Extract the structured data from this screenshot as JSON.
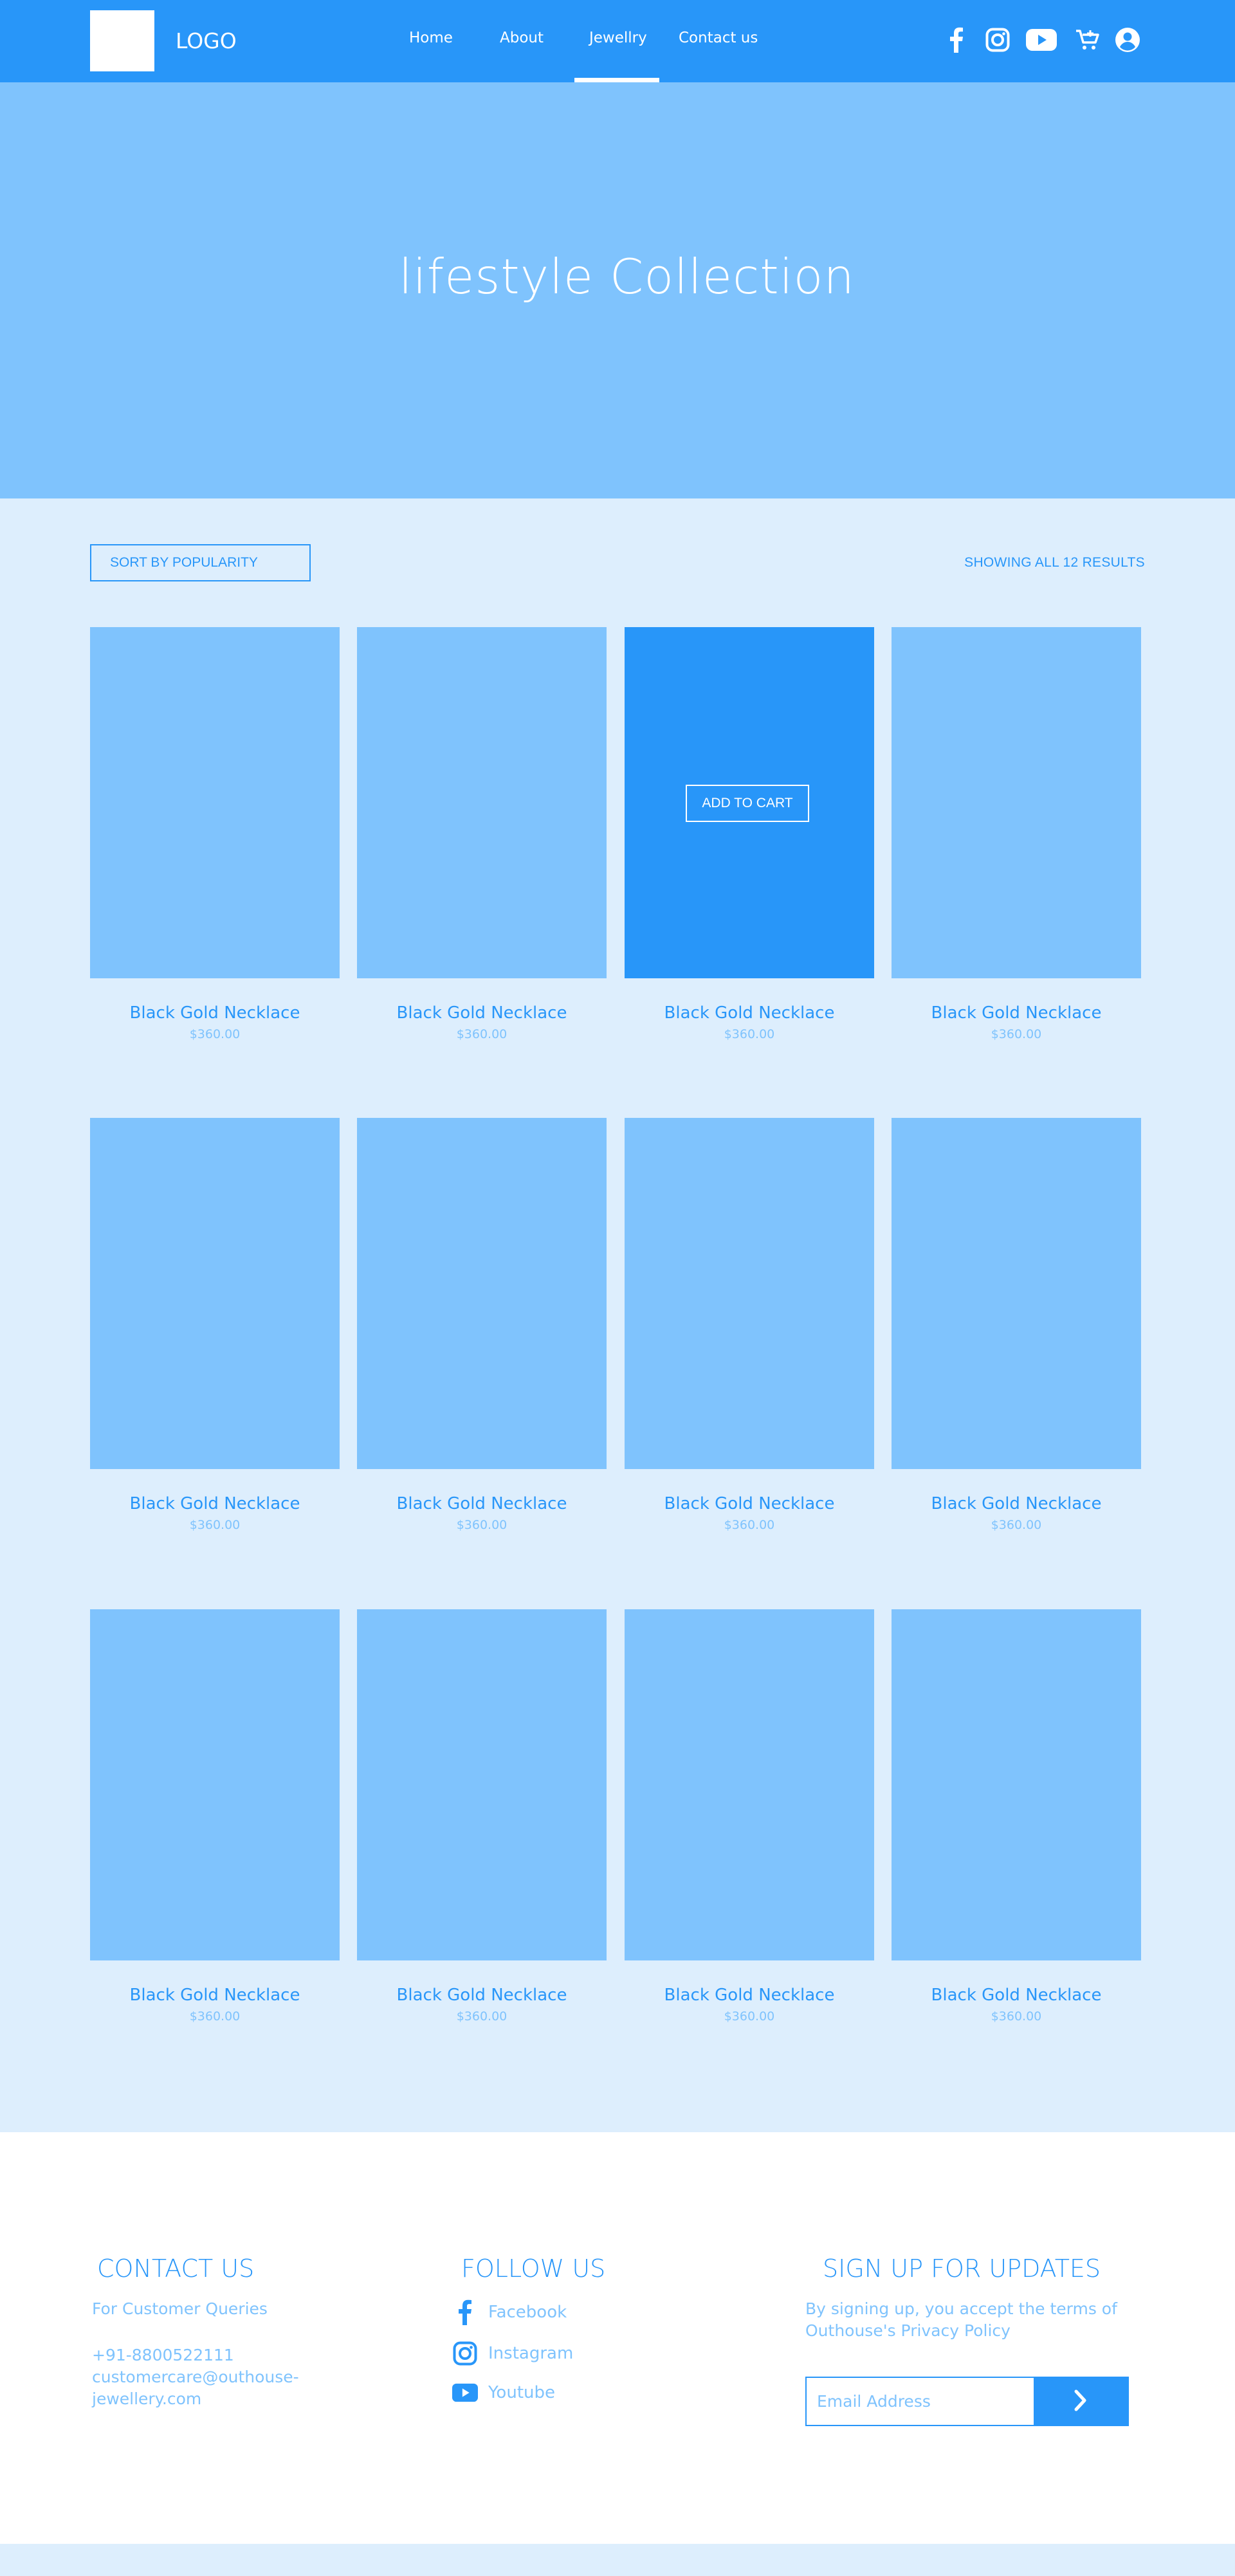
{
  "header": {
    "logo_text": "LOGO",
    "nav": [
      {
        "label": "Home"
      },
      {
        "label": "About"
      },
      {
        "label": "Jewellry",
        "active": true
      },
      {
        "label": "Contact us"
      }
    ],
    "icons": [
      "facebook-icon",
      "instagram-icon",
      "youtube-icon",
      "cart-icon",
      "account-icon"
    ]
  },
  "hero": {
    "title": "lifestyle Collection"
  },
  "toolbar": {
    "sort_label": "SORT BY POPULARITY",
    "results_label": "SHOWING ALL 12 RESULTS"
  },
  "products": [
    {
      "name": "Black Gold Necklace",
      "price": "$360.00"
    },
    {
      "name": "Black Gold Necklace",
      "price": "$360.00"
    },
    {
      "name": "Black Gold Necklace",
      "price": "$360.00",
      "hover": true,
      "cta": "ADD TO CART"
    },
    {
      "name": "Black Gold Necklace",
      "price": "$360.00"
    },
    {
      "name": "Black Gold Necklace",
      "price": "$360.00"
    },
    {
      "name": "Black Gold Necklace",
      "price": "$360.00"
    },
    {
      "name": "Black Gold Necklace",
      "price": "$360.00"
    },
    {
      "name": "Black Gold Necklace",
      "price": "$360.00"
    },
    {
      "name": "Black Gold Necklace",
      "price": "$360.00"
    },
    {
      "name": "Black Gold Necklace",
      "price": "$360.00"
    },
    {
      "name": "Black Gold Necklace",
      "price": "$360.00"
    },
    {
      "name": "Black Gold Necklace",
      "price": "$360.00"
    }
  ],
  "footer": {
    "contact": {
      "heading": "CONTACT US",
      "subheading": "For Customer Queries",
      "phone": "+91-8800522111",
      "email_line1": "customercare@outhouse-",
      "email_line2": "jewellery.com"
    },
    "follow": {
      "heading": "FOLLOW US",
      "links": [
        {
          "label": "Facebook",
          "icon": "facebook-icon"
        },
        {
          "label": "Instagram",
          "icon": "instagram-icon"
        },
        {
          "label": "Youtube",
          "icon": "youtube-icon"
        }
      ]
    },
    "signup": {
      "heading": "SIGN UP FOR UPDATES",
      "note_line1": "By signing up, you accept the terms of",
      "note_line2": "Outhouse's Privacy Policy",
      "email_placeholder": "Email Address",
      "submit_icon": "chevron-right-icon"
    }
  },
  "colors": {
    "primary": "#2896F9",
    "light": "#7FC3FD",
    "pale": "#DDEEFD",
    "white": "#FFFFFF"
  }
}
